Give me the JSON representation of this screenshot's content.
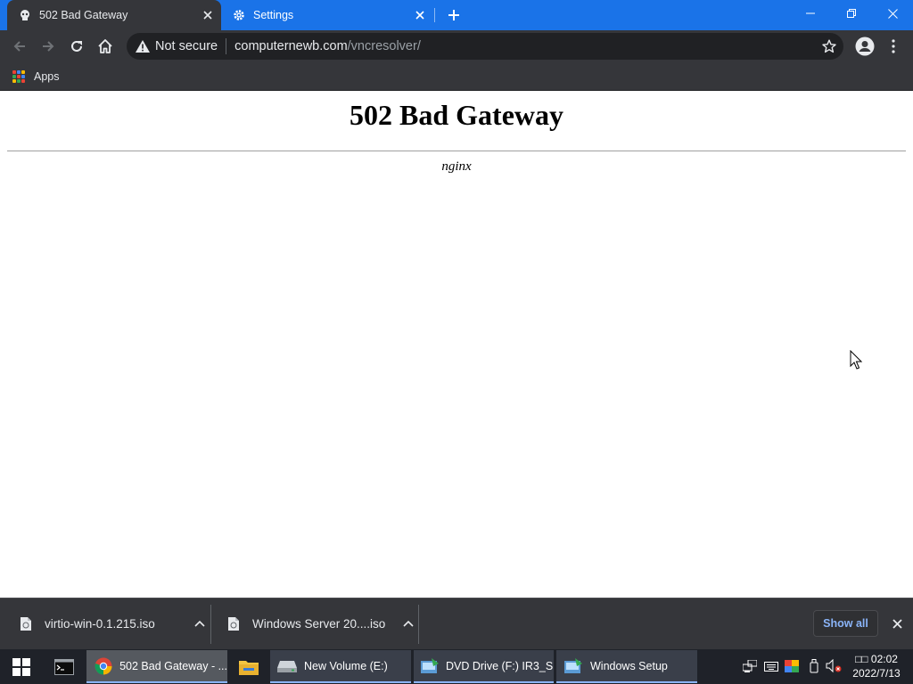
{
  "browser": {
    "tabs": [
      {
        "title": "502 Bad Gateway",
        "active": true,
        "favicon": "site-favicon"
      },
      {
        "title": "Settings",
        "active": false,
        "favicon": "gear-icon"
      }
    ],
    "address": {
      "security_label": "Not secure",
      "host": "computernewb.com",
      "path": "/vncresolver/"
    },
    "bookmarks": {
      "apps_label": "Apps"
    },
    "colors": {
      "tabstrip": "#1a73e8",
      "toolbar": "#35363a",
      "omnibox": "#202124",
      "link": "#8ab4f8"
    }
  },
  "page": {
    "heading": "502 Bad Gateway",
    "server": "nginx"
  },
  "downloads": {
    "items": [
      {
        "filename": "virtio-win-0.1.215.iso"
      },
      {
        "filename": "Windows Server 20....iso"
      }
    ],
    "show_all_label": "Show all"
  },
  "taskbar": {
    "items": [
      {
        "label": "502 Bad Gateway - ...",
        "icon": "chrome-icon"
      },
      {
        "label": "New Volume (E:)",
        "icon": "drive-icon"
      },
      {
        "label": "DVD Drive (F:) IR3_S...",
        "icon": "setup-icon"
      },
      {
        "label": "Windows Setup",
        "icon": "setup-icon"
      }
    ],
    "clock": {
      "time": "□□ 02:02",
      "date": "2022/7/13"
    }
  }
}
